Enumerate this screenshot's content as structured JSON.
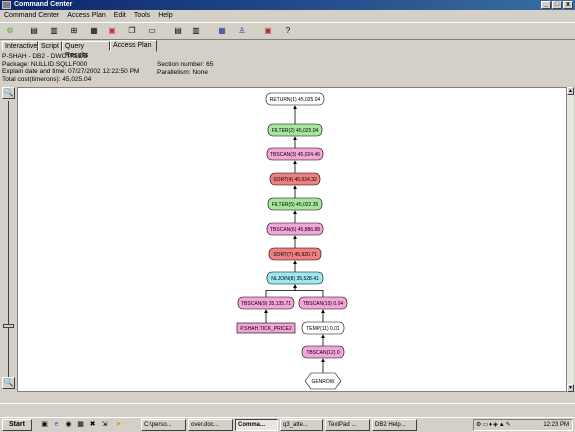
{
  "window": {
    "title": "Command Center"
  },
  "menubar": [
    "Command Center",
    "Access Plan",
    "Edit",
    "Tools",
    "Help"
  ],
  "toolbar_icons": [
    "db-icon",
    "script-icon",
    "tools-icon",
    "list-icon",
    "image-icon",
    "copy-icon",
    "panel-icon",
    "form-icon",
    "table-icon",
    "tree-icon",
    "settings-icon",
    "help-icon"
  ],
  "tabs": [
    "Interactive",
    "Script",
    "Query Results",
    "Access Plan"
  ],
  "active_tab": "Access Plan",
  "info": {
    "line1": "P-SHAH - DB2 - DWCTRLDB",
    "line2": "Package: NULLID.SQLLF000",
    "line3": "Explain date and time: 07/27/2002 12:22:50 PM",
    "line4": "Total cost(timerons): 45,025.04",
    "section": "Section number: 65",
    "parallelism": "Parallelism: None"
  },
  "plan_nodes": [
    {
      "label": "RETURN(1) 45,025.04",
      "color": "#ffffff"
    },
    {
      "label": "FILTER(2) 45,025.04",
      "color": "#a8e6a0"
    },
    {
      "label": "TBSCAN(3) 45,024.46",
      "color": "#f4a6d8"
    },
    {
      "label": "SORT(4) 45,024.32",
      "color": "#f08080"
    },
    {
      "label": "FILTER(5) 45,022.35",
      "color": "#a8e6a0"
    },
    {
      "label": "TBSCAN(6) 45,886.88",
      "color": "#f4a6d8"
    },
    {
      "label": "SORT(7) 45,920.71",
      "color": "#f08080"
    },
    {
      "label": "NLJOIN(8) 35,528.41",
      "color": "#a0e8f0"
    },
    {
      "label": "TBSCAN(9) 35,135.71",
      "color": "#f4a6d8"
    },
    {
      "label": "TBSCAN(10) 0.04",
      "color": "#f4a6d8"
    },
    {
      "label": "P.SHAH.TICK_PRICE2",
      "color": "#f4a6d8"
    },
    {
      "label": "TEMP(11) 0.01",
      "color": "#ffffff"
    },
    {
      "label": "TBSCAN(12) 0",
      "color": "#f4a6d8"
    },
    {
      "label": "GENROW",
      "color": "#ffffff"
    }
  ],
  "taskbar": {
    "start": "Start",
    "tasks": [
      "C:\\perso...",
      "over.doc...",
      "Comma...",
      "q3_atte...",
      "TextPad ...",
      "DB2 Help..."
    ],
    "active_task": "Comma...",
    "clock": "12:23 PM"
  }
}
